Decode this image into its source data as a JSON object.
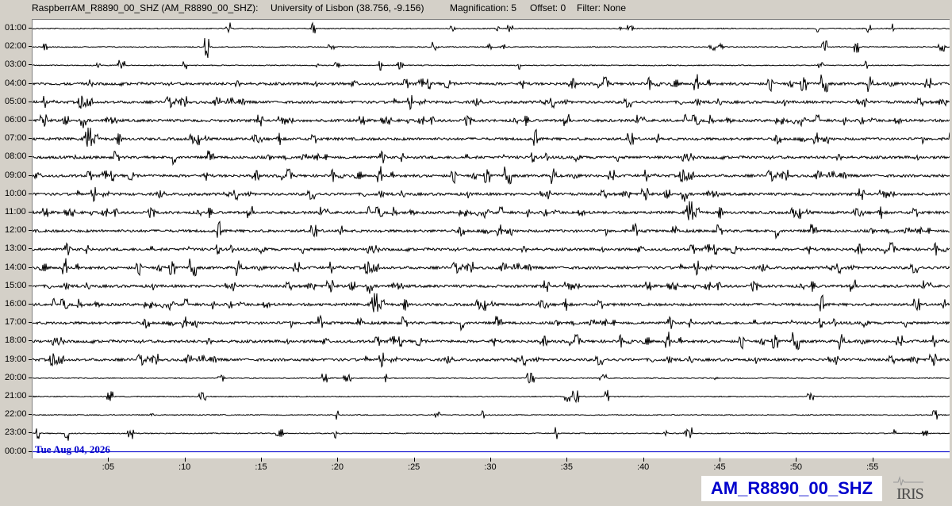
{
  "header": {
    "station_line": "RaspberrAM_R8890_00_SHZ (AM_R8890_00_SHZ):",
    "location": "University of Lisbon (38.756, -9.156)",
    "magnification": "Magnification: 5",
    "offset": "Offset: 0",
    "filter": "Filter: None"
  },
  "hours": [
    "01:00",
    "02:00",
    "03:00",
    "04:00",
    "05:00",
    "06:00",
    "07:00",
    "08:00",
    "09:00",
    "10:00",
    "11:00",
    "12:00",
    "13:00",
    "14:00",
    "15:00",
    "16:00",
    "17:00",
    "18:00",
    "19:00",
    "20:00",
    "21:00",
    "22:00",
    "23:00",
    "00:00"
  ],
  "date_label": "Tue Aug 04, 2026",
  "minute_labels": [
    ":05",
    ":10",
    ":15",
    ":20",
    ":25",
    ":30",
    ":35",
    ":40",
    ":45",
    ":50",
    ":55"
  ],
  "minute_values": [
    5,
    10,
    15,
    20,
    25,
    30,
    35,
    40,
    45,
    50,
    55
  ],
  "station_badge": "AM_R8890_00_SHZ",
  "logo_text": "IRIS",
  "colors": {
    "trace": "#000000",
    "current_line": "#0000cc",
    "badge_text": "#0000cc",
    "background": "#d4d0c8"
  }
}
